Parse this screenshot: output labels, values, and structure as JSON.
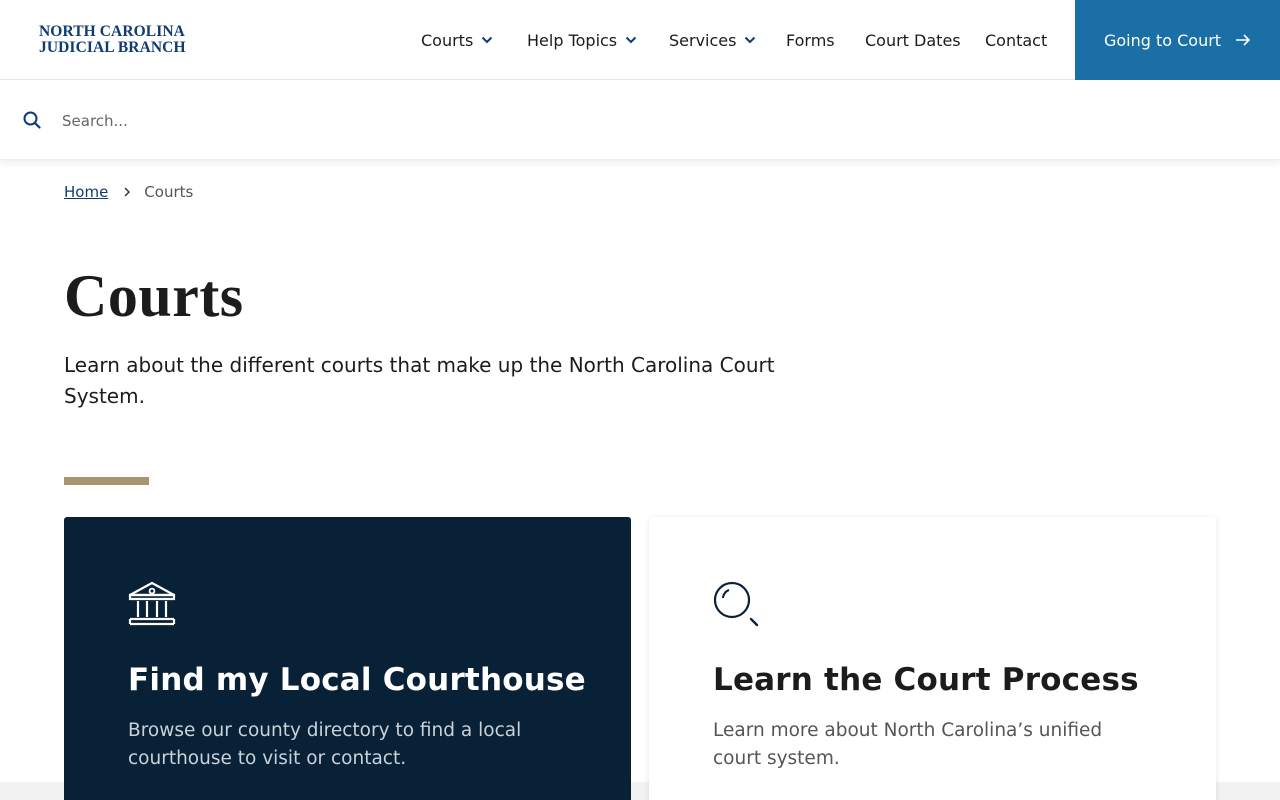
{
  "header": {
    "logo_line1": "NORTH CAROLINA",
    "logo_line2": "JUDICIAL BRANCH",
    "nav": [
      {
        "label": "Courts",
        "has_dropdown": true
      },
      {
        "label": "Help Topics",
        "has_dropdown": true
      },
      {
        "label": "Services",
        "has_dropdown": true
      },
      {
        "label": "Forms",
        "has_dropdown": false
      },
      {
        "label": "Court Dates",
        "has_dropdown": false
      },
      {
        "label": "Contact",
        "has_dropdown": false
      }
    ],
    "cta_label": "Going to Court",
    "cta_color": "#1a70a6"
  },
  "search": {
    "placeholder": "Search...",
    "icon": "search-icon"
  },
  "breadcrumb": {
    "home": "Home",
    "current": "Courts"
  },
  "page": {
    "title": "Courts",
    "intro": "Learn about the different courts that make up the North Carolina Court System.",
    "accent_color": "#a89570"
  },
  "cards": [
    {
      "icon": "courthouse-icon",
      "title": "Find my Local Courthouse",
      "description": "Browse our county directory to find a local courthouse to visit or contact.",
      "background": "#082136"
    },
    {
      "icon": "magnifier-icon",
      "title": "Learn the Court Process",
      "description": "Learn more about North Carolina’s unified court system.",
      "background": "#ffffff"
    }
  ]
}
